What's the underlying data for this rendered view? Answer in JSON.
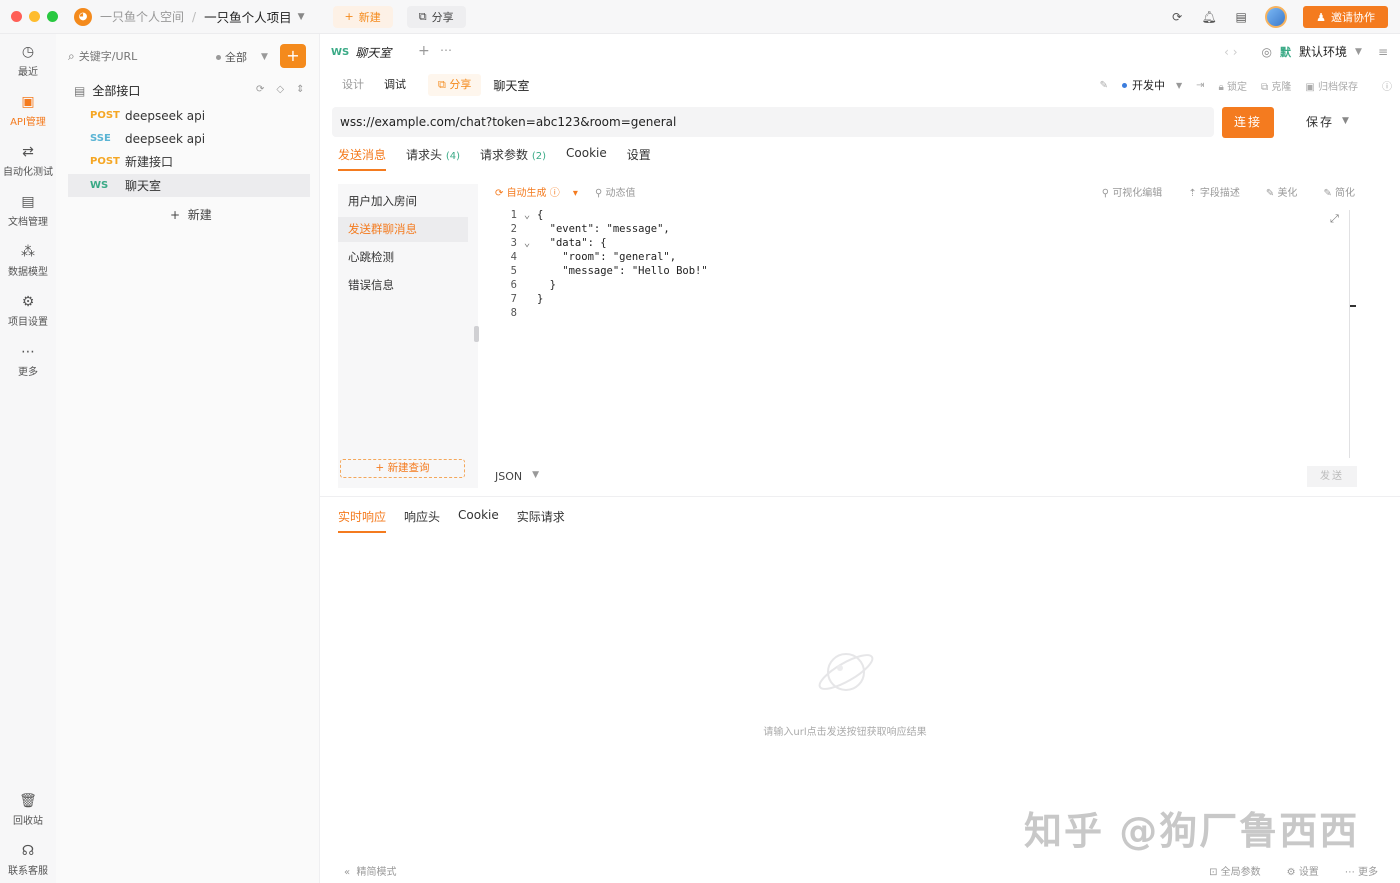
{
  "titlebar": {
    "space": "一只鱼个人空间",
    "project": "一只鱼个人项目",
    "new_label": "新建",
    "share_label": "分享",
    "invite_label": "邀请协作"
  },
  "rail": {
    "items": [
      {
        "label": "最近",
        "icon": "history-icon"
      },
      {
        "label": "API管理",
        "icon": "api-icon"
      },
      {
        "label": "自动化测试",
        "icon": "automation-icon"
      },
      {
        "label": "文档管理",
        "icon": "document-icon"
      },
      {
        "label": "数据模型",
        "icon": "model-icon"
      },
      {
        "label": "项目设置",
        "icon": "settings-icon"
      },
      {
        "label": "更多",
        "icon": "more-icon"
      }
    ],
    "bottom": [
      {
        "label": "回收站",
        "icon": "trash-icon"
      },
      {
        "label": "联系客服",
        "icon": "headset-icon"
      }
    ]
  },
  "tree": {
    "search_placeholder": "关键字/URL",
    "scope": "全部",
    "root_label": "全部接口",
    "items": [
      {
        "method": "POST",
        "name": "deepseek api"
      },
      {
        "method": "SSE",
        "name": "deepseek api"
      },
      {
        "method": "POST",
        "name": "新建接口"
      },
      {
        "method": "WS",
        "name": "聊天室"
      }
    ],
    "new_label": "新建"
  },
  "main": {
    "tab": {
      "method": "WS",
      "name": "聊天室"
    },
    "env": {
      "badge": "默",
      "name": "默认环境"
    },
    "modes": [
      "设计",
      "调试"
    ],
    "share_label": "分享",
    "request_name": "聊天室",
    "status": "开发中",
    "actions": [
      "锁定",
      "克隆",
      "归档保存"
    ],
    "url": "wss://example.com/chat?token=abc123&room=general",
    "connect_label": "连接",
    "save_label": "保存",
    "req_tabs": [
      {
        "label": "发送消息",
        "count": ""
      },
      {
        "label": "请求头",
        "count": "(4)"
      },
      {
        "label": "请求参数",
        "count": "(2)"
      },
      {
        "label": "Cookie",
        "count": ""
      },
      {
        "label": "设置",
        "count": ""
      }
    ],
    "messages": [
      "用户加入房间",
      "发送群聊消息",
      "心跳检测",
      "错误信息"
    ],
    "new_query_label": "新建查询",
    "editor_tools": {
      "auto_gen": "自动生成",
      "dynamic": "动态值",
      "right": [
        "可视化编辑",
        "字段描述",
        "美化",
        "简化"
      ]
    },
    "code_lines": [
      "{",
      "  \"event\": \"message\",",
      "  \"data\": {",
      "    \"room\": \"general\",",
      "    \"message\": \"Hello Bob!\"",
      "  }",
      "}",
      ""
    ],
    "format": "JSON",
    "send_label": "发送",
    "resp_tabs": [
      "实时响应",
      "响应头",
      "Cookie",
      "实际请求"
    ],
    "empty_text": "请输入url点击发送按钮获取响应结果"
  },
  "footer": {
    "left": "精简模式",
    "right": [
      "全局参数",
      "设置",
      "更多"
    ]
  },
  "watermark": "知乎 @狗厂鲁西西"
}
